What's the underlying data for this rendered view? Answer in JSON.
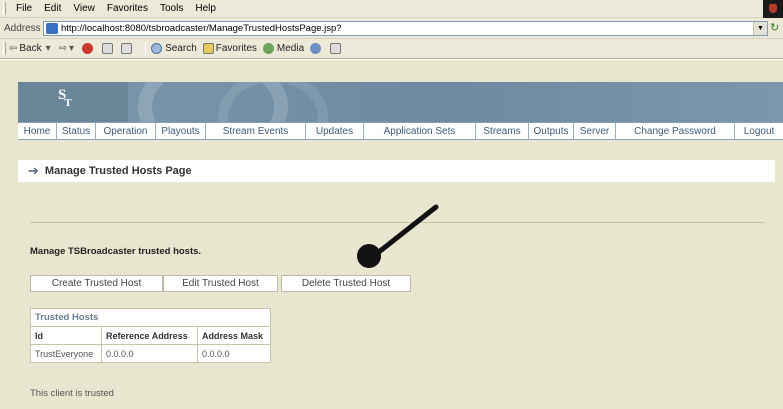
{
  "browser": {
    "menu": [
      "File",
      "Edit",
      "View",
      "Favorites",
      "Tools",
      "Help"
    ],
    "address_label": "Address",
    "url": "http://localhost:8080/tsbroadcaster/ManageTrustedHostsPage.jsp?",
    "toolbar": {
      "back": "Back",
      "search": "Search",
      "favorites": "Favorites",
      "media": "Media"
    }
  },
  "app": {
    "nav": [
      "Home",
      "Status",
      "Operation",
      "Playouts",
      "Stream Events",
      "Updates",
      "Application Sets",
      "Streams",
      "Outputs",
      "Server",
      "Change Password",
      "Logout"
    ],
    "page_title": "Manage Trusted Hosts Page",
    "intro": "Manage TSBroadcaster trusted hosts.",
    "buttons": {
      "create": "Create Trusted Host",
      "edit": "Edit Trusted Host",
      "delete": "Delete Trusted Host"
    },
    "table": {
      "caption": "Trusted Hosts",
      "columns": [
        "Id",
        "Reference Address",
        "Address Mask"
      ],
      "rows": [
        [
          "TrustEveryone",
          "0.0.0.0",
          "0.0.0.0"
        ]
      ]
    },
    "footer": "This client is trusted"
  },
  "colors": {
    "page_bg": "#e8e6cf",
    "banner": "#7c98ad",
    "nav_text": "#3f5a78"
  }
}
